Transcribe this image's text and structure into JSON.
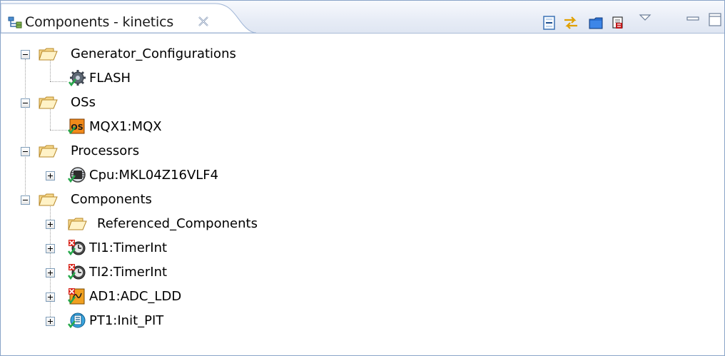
{
  "view": {
    "tab_title": "Components - kinetics",
    "tab_icon": "components-view-icon",
    "close_icon": "close-icon",
    "toolbar": [
      {
        "name": "collapse-all-icon"
      },
      {
        "name": "link-with-editor-icon"
      },
      {
        "name": "open-folder-icon"
      },
      {
        "name": "generate-code-icon"
      },
      {
        "name": "view-menu-icon"
      },
      {
        "name": "minimize-icon"
      },
      {
        "name": "maximize-icon"
      }
    ]
  },
  "tree": {
    "nodes": [
      {
        "label": "Generator_Configurations",
        "icon": "folder-icon",
        "expander": "minus"
      },
      {
        "label": "FLASH",
        "icon": "configuration-gear-icon",
        "expander": ""
      },
      {
        "label": "OSs",
        "icon": "folder-icon",
        "expander": "minus"
      },
      {
        "label": "MQX1:MQX",
        "icon": "os-component-icon",
        "expander": ""
      },
      {
        "label": "Processors",
        "icon": "folder-icon",
        "expander": "minus"
      },
      {
        "label": "Cpu:MKL04Z16VLF4",
        "icon": "cpu-chip-icon",
        "expander": "plus"
      },
      {
        "label": "Components",
        "icon": "folder-icon",
        "expander": "minus"
      },
      {
        "label": "Referenced_Components",
        "icon": "folder-icon",
        "expander": "plus"
      },
      {
        "label": "TI1:TimerInt",
        "icon": "timer-component-icon",
        "expander": "plus"
      },
      {
        "label": "TI2:TimerInt",
        "icon": "timer-component-icon",
        "expander": "plus"
      },
      {
        "label": "AD1:ADC_LDD",
        "icon": "adc-component-icon",
        "expander": "plus"
      },
      {
        "label": "PT1:Init_PIT",
        "icon": "pit-component-icon",
        "expander": "plus"
      }
    ]
  }
}
